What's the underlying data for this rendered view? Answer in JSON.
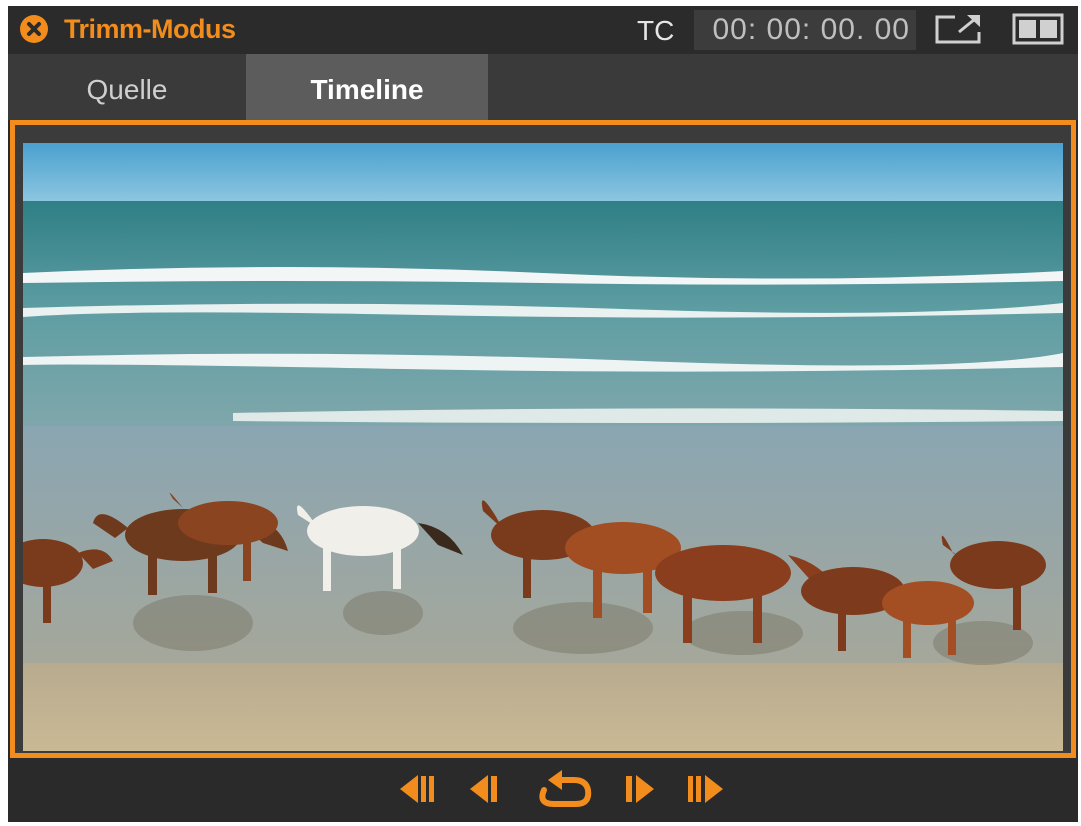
{
  "window": {
    "title": "Trimm-Modus",
    "timecode_label": "TC",
    "timecode_value": "00: 00: 00. 00"
  },
  "tabs": [
    {
      "label": "Quelle",
      "active": false
    },
    {
      "label": "Timeline",
      "active": true
    }
  ],
  "transport": {
    "buttons": [
      "jump-to-start-icon",
      "step-back-icon",
      "loop-icon",
      "step-forward-icon",
      "jump-to-end-icon"
    ]
  },
  "colors": {
    "accent": "#f28c1c",
    "titlebar": "#2b2b2b",
    "tab_active": "#5c5c5c",
    "tab_inactive": "#3a3a3a"
  },
  "preview": {
    "content": "video-frame-horses-running-on-beach"
  }
}
